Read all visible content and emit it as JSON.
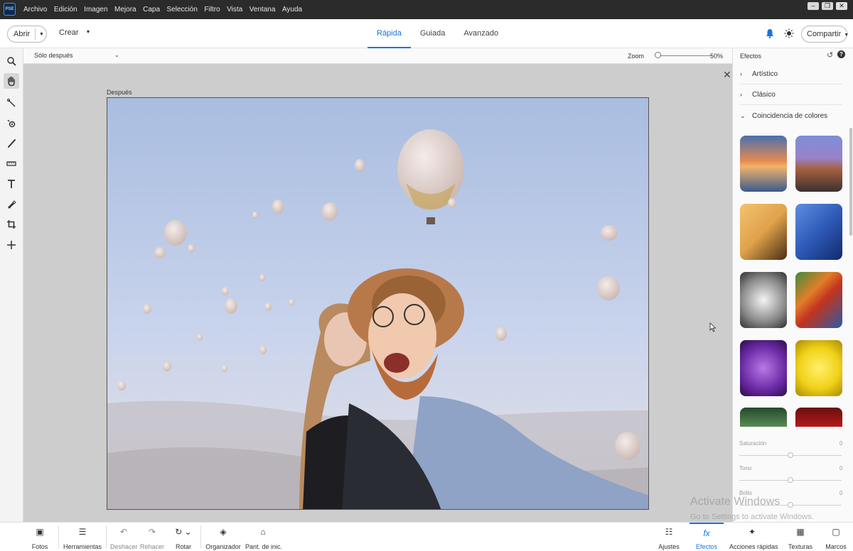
{
  "titlebar": {
    "logo": "PSE",
    "menu": [
      "Archivo",
      "Edición",
      "Imagen",
      "Mejora",
      "Capa",
      "Selección",
      "Filtro",
      "Vista",
      "Ventana",
      "Ayuda"
    ]
  },
  "topbar": {
    "open_label": "Abrir",
    "create_label": "Crear",
    "tabs": [
      "Rápida",
      "Guiada",
      "Avanzado"
    ],
    "active_tab": "Rápida",
    "share_label": "Compartir"
  },
  "optbar": {
    "view": "Sólo después",
    "zoom_label": "Zoom",
    "zoom_value": "50%",
    "zoom_level": 0.05
  },
  "canvas": {
    "after_label": "Después"
  },
  "panel": {
    "title": "Efectos",
    "categories": [
      {
        "label": "Artístico",
        "expanded": false
      },
      {
        "label": "Clásico",
        "expanded": false
      },
      {
        "label": "Coincidencia de colores",
        "expanded": true
      }
    ],
    "sliders": [
      {
        "label": "Saturación",
        "value": "0"
      },
      {
        "label": "Tono",
        "value": "0"
      },
      {
        "label": "Brillo",
        "value": "0"
      }
    ]
  },
  "watermark": {
    "title": "Activate Windows",
    "sub": "Go to Settings to activate Windows."
  },
  "bottombar": {
    "items": [
      {
        "label": "Fotos",
        "icon": "photos-icon"
      },
      {
        "label": "Herramientas",
        "icon": "tools-icon"
      },
      {
        "label": "Deshacer",
        "icon": "undo-icon"
      },
      {
        "label": "Rehacer",
        "icon": "redo-icon"
      },
      {
        "label": "Rotar",
        "icon": "rotate-icon"
      },
      {
        "label": "Organizador",
        "icon": "organizer-icon"
      },
      {
        "label": "Pant. de inic.",
        "icon": "home-icon"
      },
      {
        "label": "Ajustes",
        "icon": "adjustments-icon"
      },
      {
        "label": "Efectos",
        "icon": "fx-icon"
      },
      {
        "label": "Acciones rápidas",
        "icon": "quick-actions-icon"
      },
      {
        "label": "Texturas",
        "icon": "textures-icon"
      },
      {
        "label": "Marcos",
        "icon": "frames-icon"
      }
    ]
  },
  "colors": {
    "accent": "#1473e6",
    "titlebar": "#2b2b2b"
  }
}
